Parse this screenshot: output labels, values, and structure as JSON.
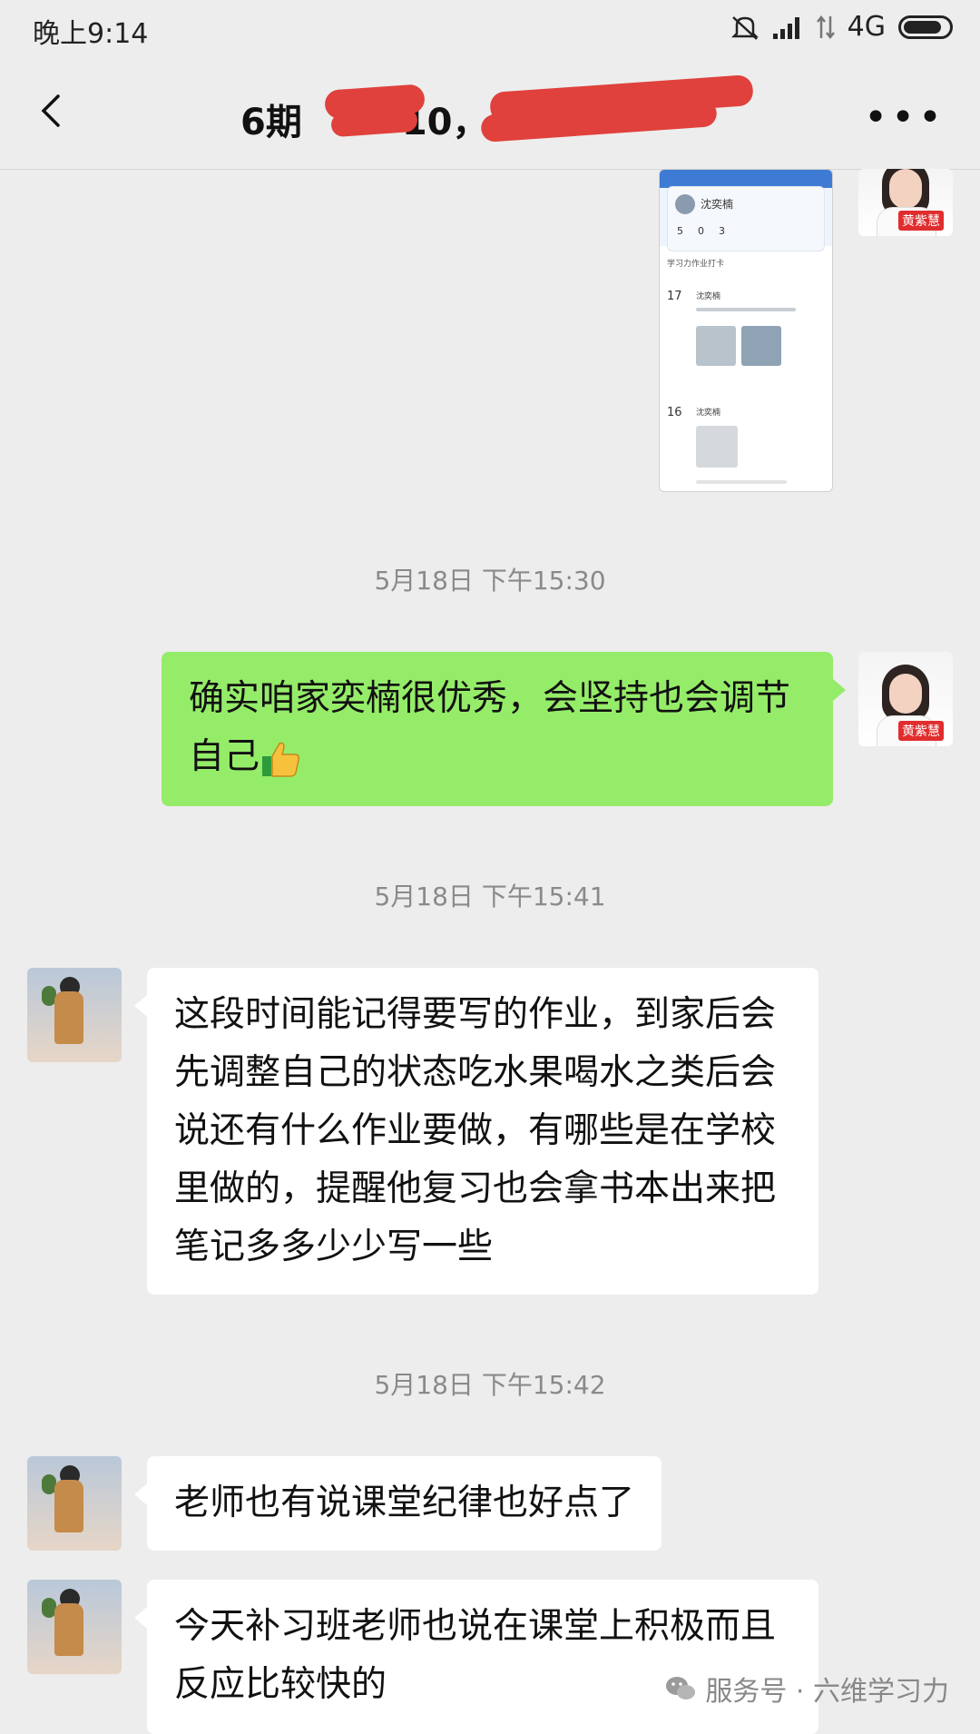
{
  "status_bar": {
    "time": "晚上9:14",
    "network": "4G"
  },
  "header": {
    "title_visible": "6期",
    "title_tail": "10，"
  },
  "screenshot_thumb": {
    "name": "沈奕楠",
    "stats": [
      "5",
      "0",
      "3"
    ],
    "row1_label": "学习力作业打卡",
    "day1": "17",
    "day1_name": "沈奕楠",
    "day2": "16",
    "day2_name": "沈奕楠"
  },
  "teacher": {
    "tag": "黄紫慧"
  },
  "messages": [
    {
      "type": "time",
      "text": "5月18日 下午15:30"
    },
    {
      "type": "me",
      "text": "确实咱家奕楠很优秀，会坚持也会调节自己"
    },
    {
      "type": "time",
      "text": "5月18日 下午15:41"
    },
    {
      "type": "other",
      "text": "这段时间能记得要写的作业，到家后会先调整自己的状态吃水果喝水之类后会说还有什么作业要做，有哪些是在学校里做的，提醒他复习也会拿书本出来把笔记多多少少写一些"
    },
    {
      "type": "time",
      "text": "5月18日 下午15:42"
    },
    {
      "type": "other",
      "text": "老师也有说课堂纪律也好点了"
    },
    {
      "type": "other",
      "text": "今天补习班老师也说在课堂上积极而且反应比较快的"
    }
  ],
  "watermark": "服务号 · 六维学习力",
  "icons": [
    "back-arrow-icon",
    "more-icon",
    "mute-icon",
    "signal-icon",
    "battery-icon",
    "thumbs-up-icon",
    "wechat-icon"
  ]
}
